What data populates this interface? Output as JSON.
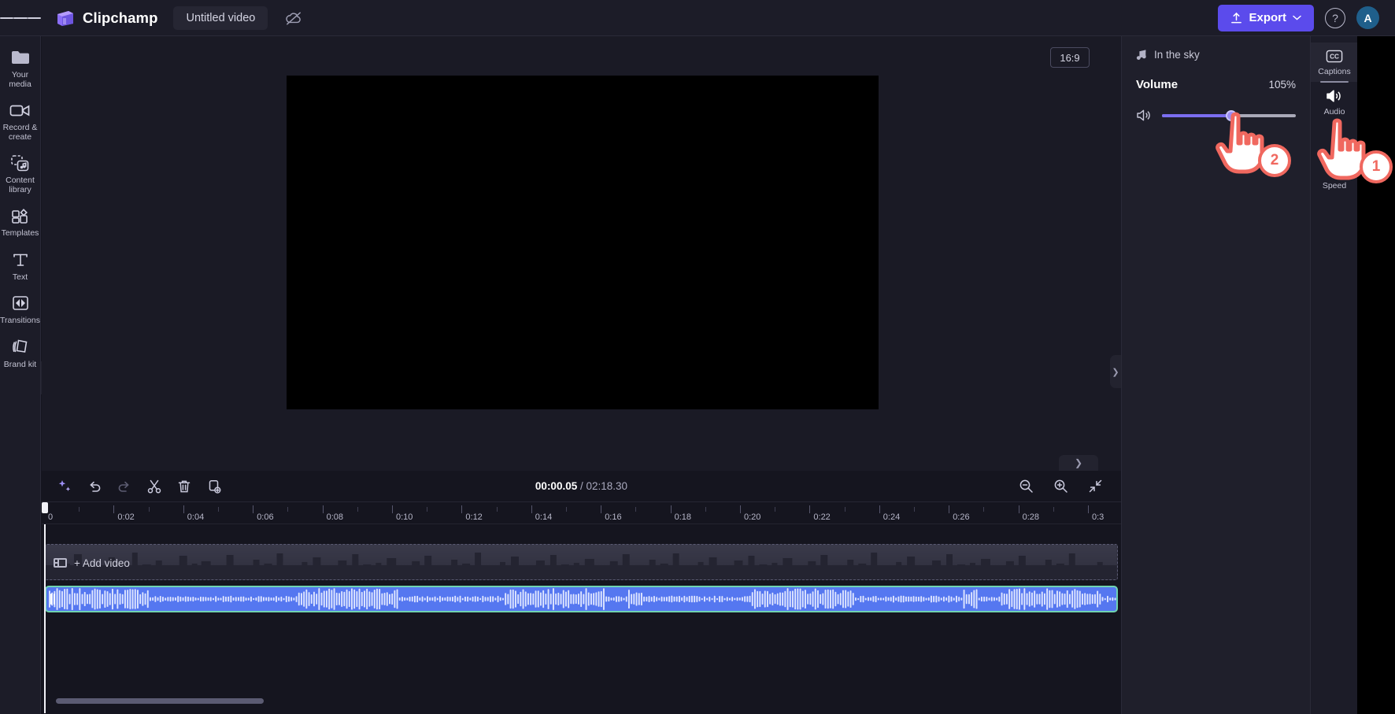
{
  "topbar": {
    "menu_icon": "hamburger-icon",
    "brand_name": "Clipchamp",
    "project_title": "Untitled video",
    "cloud_icon": "cloud-off-icon",
    "export_label": "Export",
    "export_icon": "upload-icon",
    "export_chevron": "chevron-down-icon",
    "help_label": "?",
    "avatar_initial": "A",
    "accent_color": "#5b4bec"
  },
  "left_rail": {
    "items": [
      {
        "label": "Your media",
        "icon": "folder-icon"
      },
      {
        "label": "Record & create",
        "icon": "video-camera-icon"
      },
      {
        "label": "Content library",
        "icon": "content-library-icon"
      },
      {
        "label": "Templates",
        "icon": "templates-icon"
      },
      {
        "label": "Text",
        "icon": "text-icon"
      },
      {
        "label": "Transitions",
        "icon": "transitions-icon"
      },
      {
        "label": "Brand kit",
        "icon": "brand-kit-icon"
      }
    ],
    "expand_chevron": "chevron-right-icon"
  },
  "stage": {
    "aspect_ratio": "16:9",
    "magic_icon": "auto-compose-icon",
    "right_chevron": "chevron-right-icon",
    "collapse_chevron": "chevron-down-icon",
    "transport": [
      {
        "name": "skip-to-start-button",
        "icon": "skip-start-icon"
      },
      {
        "name": "rewind-5-button",
        "icon": "rewind-5-icon"
      },
      {
        "name": "play-button",
        "icon": "play-icon"
      },
      {
        "name": "forward-5-button",
        "icon": "forward-5-icon"
      },
      {
        "name": "skip-to-end-button",
        "icon": "skip-end-icon"
      }
    ],
    "fullscreen_icon": "fullscreen-icon"
  },
  "properties": {
    "clip_icon": "music-note-icon",
    "clip_name": "In the sky",
    "volume_label": "Volume",
    "volume_value": "105%",
    "volume_percent": 52,
    "speaker_icon": "speaker-icon",
    "slider_fill_color": "#7b6ef0",
    "slider_track_color": "#a9a9b8"
  },
  "tool_rail": {
    "items": [
      {
        "label": "Captions",
        "icon": "closed-captions-icon",
        "active": true
      },
      {
        "label": "Audio",
        "icon": "speaker-loud-icon",
        "active": false
      },
      {
        "label": "",
        "icon": "hidden-icon",
        "active": false
      },
      {
        "label": "Speed",
        "icon": "speedometer-icon",
        "active": false
      }
    ]
  },
  "timeline": {
    "tools": [
      {
        "name": "ai-suggest-button",
        "icon": "sparkle-icon"
      },
      {
        "name": "undo-button",
        "icon": "undo-icon"
      },
      {
        "name": "redo-button",
        "icon": "redo-icon"
      },
      {
        "name": "split-button",
        "icon": "scissors-icon"
      },
      {
        "name": "delete-button",
        "icon": "trash-icon"
      },
      {
        "name": "duplicate-button",
        "icon": "duplicate-icon"
      }
    ],
    "current_time": "00:00.05",
    "separator": "/",
    "total_time": "02:18.30",
    "zoom_out_icon": "zoom-out-icon",
    "zoom_in_icon": "zoom-in-icon",
    "fit_icon": "fit-to-screen-icon",
    "ruler_labels": [
      "0",
      "0:02",
      "0:04",
      "0:06",
      "0:08",
      "0:10",
      "0:12",
      "0:14",
      "0:16",
      "0:18",
      "0:20",
      "0:22",
      "0:24",
      "0:26",
      "0:28",
      "0:3"
    ],
    "video_track": {
      "add_label": "+ Add video",
      "icon": "film-strip-icon"
    },
    "audio_track": {
      "clip_color": "#5577f0",
      "selection_color": "#6fd3b0"
    },
    "scrollbar": "horizontal-scrollbar"
  },
  "annotations": [
    {
      "number": "1",
      "target": "audio-tool-tab"
    },
    {
      "number": "2",
      "target": "volume-slider-knob"
    }
  ]
}
